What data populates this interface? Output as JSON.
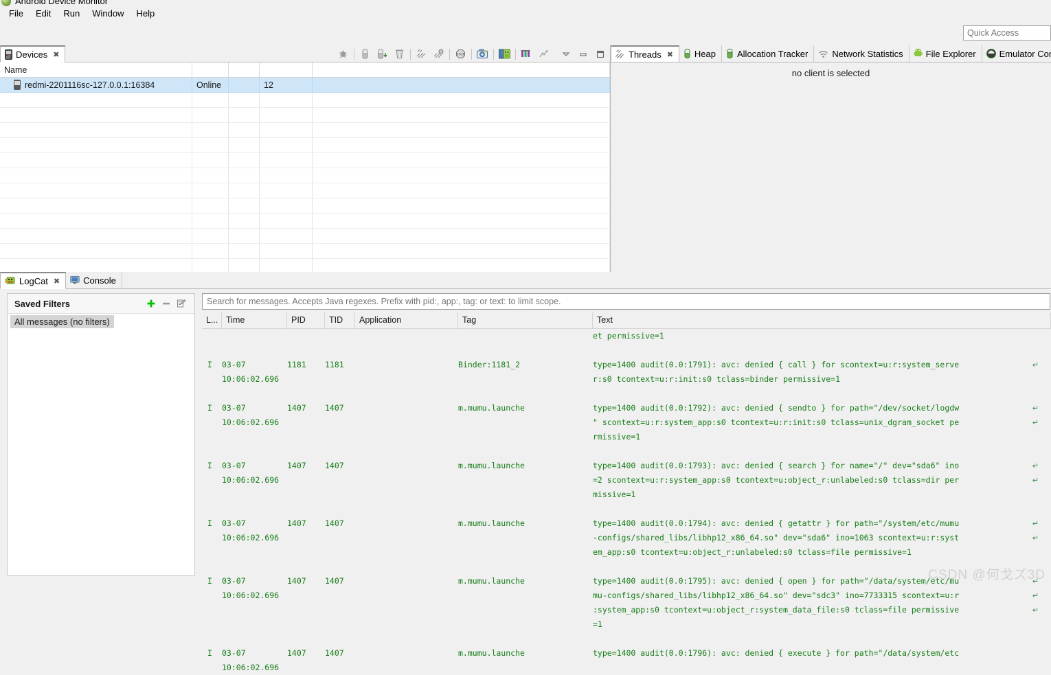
{
  "window": {
    "title": "Android Device Monitor",
    "logo_icon": "android-monitor-logo-icon"
  },
  "menubar": {
    "items": [
      {
        "label": "File"
      },
      {
        "label": "Edit"
      },
      {
        "label": "Run"
      },
      {
        "label": "Window"
      },
      {
        "label": "Help"
      }
    ]
  },
  "quick_access": {
    "placeholder": "Quick Access",
    "value": ""
  },
  "devices_panel": {
    "tab_label": "Devices",
    "tab_icon": "device-phone-icon",
    "close_icon": "close-icon",
    "toolbar": [
      {
        "name": "debug-process-icon",
        "title": "Debug Process"
      },
      {
        "name": "update-heap-icon",
        "title": "Update Heap"
      },
      {
        "name": "dump-hprof-icon",
        "title": "Dump HPROF file"
      },
      {
        "name": "cause-gc-icon",
        "title": "Cause GC"
      },
      {
        "name": "update-threads-icon",
        "title": "Update Threads"
      },
      {
        "name": "start-method-profiling-icon",
        "title": "Start Method Profiling"
      },
      {
        "name": "stop-process-icon",
        "title": "Stop Process"
      },
      {
        "name": "screen-capture-icon",
        "title": "Screen Capture"
      },
      {
        "name": "dump-view-hierarchy-icon",
        "title": "Dump View Hierarchy"
      },
      {
        "name": "capture-opengl-trace-icon",
        "title": "Capture OpenGL ES Trace"
      },
      {
        "name": "systrace-icon",
        "title": "Capture System Wide Trace"
      },
      {
        "name": "view-menu-icon",
        "title": "View Menu"
      },
      {
        "name": "minimize-icon",
        "title": "Minimize"
      },
      {
        "name": "maximize-icon",
        "title": "Maximize"
      }
    ],
    "columns": [
      "Name",
      "",
      "",
      "",
      ""
    ],
    "rows": [
      {
        "icon": "device-phone-icon",
        "name": "redmi-2201116sc-127.0.0.1:16384",
        "status": "Online",
        "col3": "",
        "api": "12",
        "col5": "",
        "selected": true
      }
    ],
    "empty_row_count": 13
  },
  "right_panel": {
    "tabs": [
      {
        "label": "Threads",
        "icon": "threads-icon",
        "active": true,
        "close_icon": "close-icon"
      },
      {
        "label": "Heap",
        "icon": "heap-icon",
        "active": false
      },
      {
        "label": "Allocation Tracker",
        "icon": "allocation-tracker-icon",
        "active": false
      },
      {
        "label": "Network Statistics",
        "icon": "network-statistics-icon",
        "active": false
      },
      {
        "label": "File Explorer",
        "icon": "file-explorer-icon",
        "active": false
      },
      {
        "label": "Emulator Contro",
        "icon": "emulator-control-icon",
        "active": false
      }
    ],
    "message": "no client is selected"
  },
  "logcat_panel": {
    "tabs": [
      {
        "label": "LogCat",
        "icon": "logcat-icon",
        "active": true,
        "close_icon": "close-icon"
      },
      {
        "label": "Console",
        "icon": "console-icon",
        "active": false
      }
    ],
    "saved_filters": {
      "title": "Saved Filters",
      "add_icon": "plus-icon",
      "remove_icon": "minus-icon",
      "edit_icon": "edit-icon",
      "items": [
        {
          "label": "All messages (no filters)",
          "selected": true
        }
      ]
    },
    "search": {
      "placeholder": "Search for messages. Accepts Java regexes. Prefix with pid:, app:, tag: or text: to limit scope.",
      "value": ""
    },
    "columns": [
      "L...",
      "Time",
      "PID",
      "TID",
      "Application",
      "Tag",
      "Text"
    ],
    "rows": [
      {
        "level": "",
        "time": "",
        "pid": "",
        "tid": "",
        "application": "",
        "tag": "",
        "text_lines": [
          {
            "text": "et permissive=1",
            "wrap": false
          }
        ]
      },
      {
        "level": "I",
        "time": "03-07 10:06:02.696",
        "pid": "1181",
        "tid": "1181",
        "application": "",
        "tag": "Binder:1181_2",
        "text_lines": [
          {
            "text": "type=1400 audit(0.0:1791): avc: denied { call } for scontext=u:r:system_serve",
            "wrap": true
          },
          {
            "text": "r:s0 tcontext=u:r:init:s0 tclass=binder permissive=1",
            "wrap": false
          }
        ]
      },
      {
        "level": "I",
        "time": "03-07 10:06:02.696",
        "pid": "1407",
        "tid": "1407",
        "application": "",
        "tag": "m.mumu.launche",
        "text_lines": [
          {
            "text": "type=1400 audit(0.0:1792): avc: denied { sendto } for path=\"/dev/socket/logdw",
            "wrap": true
          },
          {
            "text": "\" scontext=u:r:system_app:s0 tcontext=u:r:init:s0 tclass=unix_dgram_socket pe",
            "wrap": true
          },
          {
            "text": "rmissive=1",
            "wrap": false
          }
        ]
      },
      {
        "level": "I",
        "time": "03-07 10:06:02.696",
        "pid": "1407",
        "tid": "1407",
        "application": "",
        "tag": "m.mumu.launche",
        "text_lines": [
          {
            "text": "type=1400 audit(0.0:1793): avc: denied { search } for name=\"/\" dev=\"sda6\" ino",
            "wrap": true
          },
          {
            "text": "=2 scontext=u:r:system_app:s0 tcontext=u:object_r:unlabeled:s0 tclass=dir per",
            "wrap": true
          },
          {
            "text": "missive=1",
            "wrap": false
          }
        ]
      },
      {
        "level": "I",
        "time": "03-07 10:06:02.696",
        "pid": "1407",
        "tid": "1407",
        "application": "",
        "tag": "m.mumu.launche",
        "text_lines": [
          {
            "text": "type=1400 audit(0.0:1794): avc: denied { getattr } for path=\"/system/etc/mumu",
            "wrap": true
          },
          {
            "text": "-configs/shared_libs/libhp12_x86_64.so\" dev=\"sda6\" ino=1063 scontext=u:r:syst",
            "wrap": true
          },
          {
            "text": "em_app:s0 tcontext=u:object_r:unlabeled:s0 tclass=file permissive=1",
            "wrap": false
          }
        ]
      },
      {
        "level": "I",
        "time": "03-07 10:06:02.696",
        "pid": "1407",
        "tid": "1407",
        "application": "",
        "tag": "m.mumu.launche",
        "text_lines": [
          {
            "text": "type=1400 audit(0.0:1795): avc: denied { open } for path=\"/data/system/etc/mu",
            "wrap": true
          },
          {
            "text": "mu-configs/shared_libs/libhp12_x86_64.so\" dev=\"sdc3\" ino=7733315 scontext=u:r",
            "wrap": true
          },
          {
            "text": ":system_app:s0 tcontext=u:object_r:system_data_file:s0 tclass=file permissive",
            "wrap": true
          },
          {
            "text": "=1",
            "wrap": false
          }
        ]
      },
      {
        "level": "I",
        "time": "03-07 10:06:02.696",
        "pid": "1407",
        "tid": "1407",
        "application": "",
        "tag": "m.mumu.launche",
        "text_lines": [
          {
            "text": "type=1400 audit(0.0:1796): avc: denied { execute } for path=\"/data/system/etc",
            "wrap": false
          }
        ]
      }
    ]
  },
  "watermark": {
    "text": "CSDN @何戈ズ3D"
  },
  "colors": {
    "log_text": "#167d17",
    "selection": "#cfe6f9",
    "panel_bg": "#f0f0f0",
    "accent_green": "#00c000"
  }
}
